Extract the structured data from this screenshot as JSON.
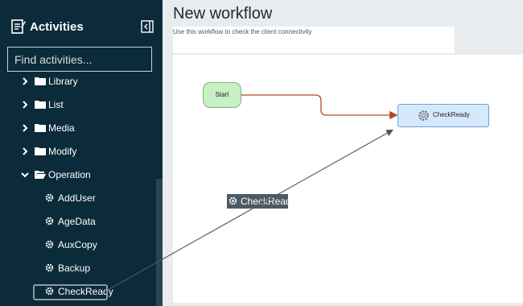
{
  "sidebar": {
    "title": "Activities",
    "search_placeholder": "Find activities...",
    "folders": [
      {
        "label": "Library",
        "expanded": false
      },
      {
        "label": "List",
        "expanded": false
      },
      {
        "label": "Media",
        "expanded": false
      },
      {
        "label": "Modify",
        "expanded": false
      },
      {
        "label": "Operation",
        "expanded": true
      }
    ],
    "operation_items": [
      "AddUser",
      "AgeData",
      "AuxCopy",
      "Backup",
      "CheckReady"
    ],
    "selected_item": "CheckReady"
  },
  "workflow": {
    "title": "New workflow",
    "description": "Use this workflow to check the client connectivity",
    "nodes": {
      "start": "Start",
      "check_ready": "CheckReady"
    },
    "drag_ghost": "CheckReady"
  },
  "colors": {
    "sidebar_bg": "#0b2b3a",
    "start_node_fill": "#c9efc4",
    "check_node_fill": "#d6e8fb",
    "connector": "#b44a1a"
  },
  "icons": {
    "title_icon": "activities-icon",
    "collapse_icon": "collapse-panel-icon",
    "gear_icon": "gear-icon",
    "folder_icon": "folder-icon",
    "chevron_icon": "chevron-icon"
  }
}
